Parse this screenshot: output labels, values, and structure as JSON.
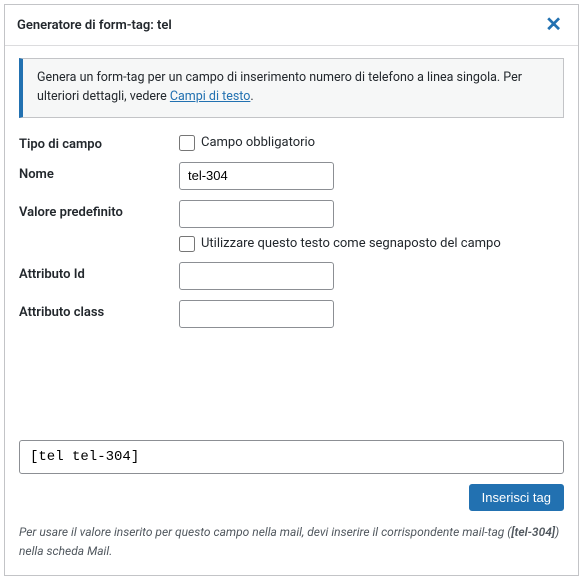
{
  "header": {
    "title": "Generatore di form-tag: tel",
    "close": "✕"
  },
  "info": {
    "text_before": "Genera un form-tag per un campo di inserimento numero di telefono a linea singola. Per ulteriori dettagli, vedere ",
    "link": "Campi di testo",
    "text_after": "."
  },
  "fields": {
    "fieldtype": {
      "label": "Tipo di campo",
      "required_label": "Campo obbligatorio"
    },
    "name": {
      "label": "Nome",
      "value": "tel-304"
    },
    "default": {
      "label": "Valore predefinito",
      "value": "",
      "placeholder_label": "Utilizzare questo testo come segnaposto del campo"
    },
    "id": {
      "label": "Attributo Id",
      "value": ""
    },
    "class": {
      "label": "Attributo class",
      "value": ""
    }
  },
  "output": {
    "tag": "[tel tel-304]",
    "insert_label": "Inserisci tag"
  },
  "hint": {
    "before": "Per usare il valore inserito per questo campo nella mail, devi inserire il corrispondente mail-tag (",
    "bold": "[tel-304]",
    "after": ") nella scheda Mail."
  }
}
